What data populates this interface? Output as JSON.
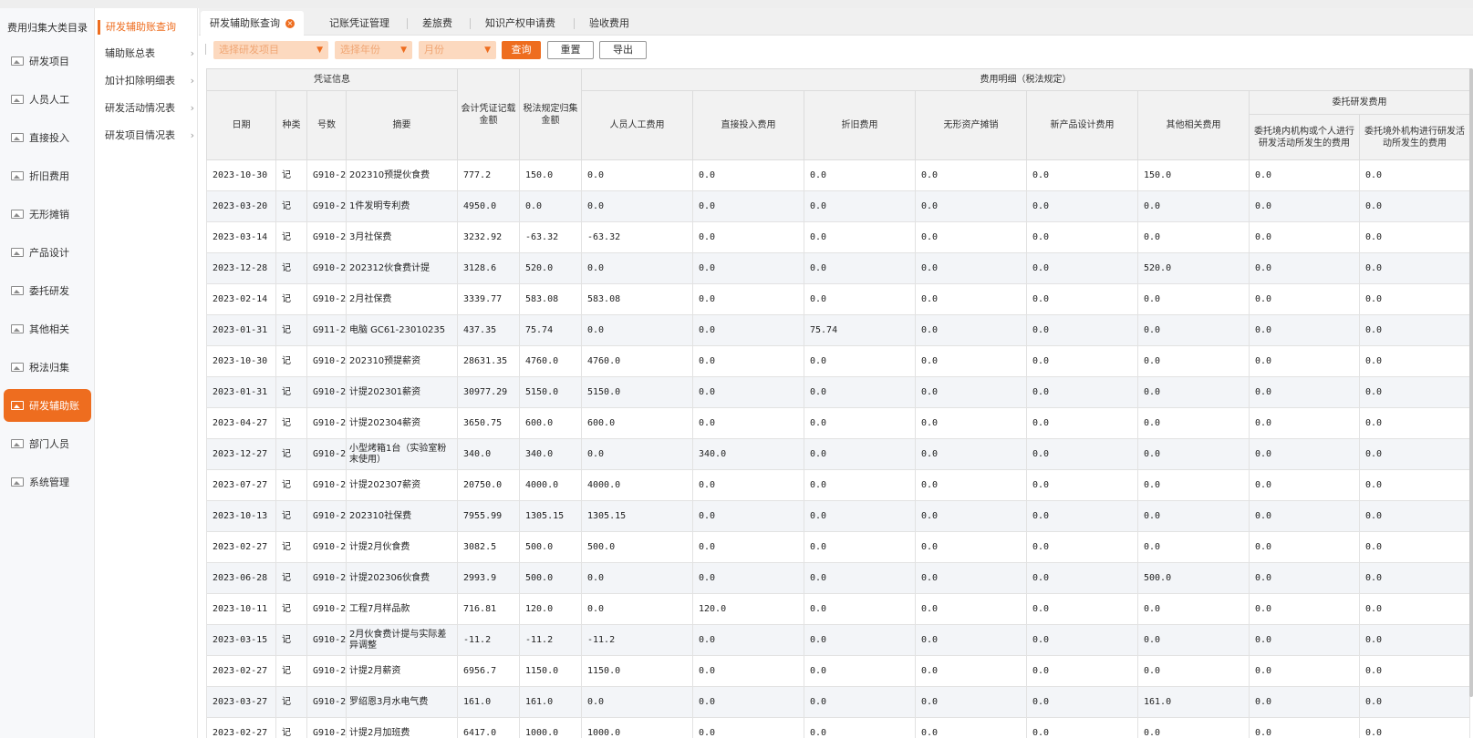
{
  "sidebar": {
    "title": "费用归集大类目录",
    "items": [
      {
        "label": "研发项目",
        "active": false
      },
      {
        "label": "人员人工",
        "active": false
      },
      {
        "label": "直接投入",
        "active": false
      },
      {
        "label": "折旧费用",
        "active": false
      },
      {
        "label": "无形摊销",
        "active": false
      },
      {
        "label": "产品设计",
        "active": false
      },
      {
        "label": "委托研发",
        "active": false
      },
      {
        "label": "其他相关",
        "active": false
      },
      {
        "label": "税法归集",
        "active": false
      },
      {
        "label": "研发辅助账",
        "active": true
      },
      {
        "label": "部门人员",
        "active": false
      },
      {
        "label": "系统管理",
        "active": false
      }
    ]
  },
  "submenu": {
    "header": "研发辅助账查询",
    "items": [
      "辅助账总表",
      "加计扣除明细表",
      "研发活动情况表",
      "研发项目情况表"
    ],
    "chevron": "›"
  },
  "tabs": [
    {
      "label": "研发辅助账查询",
      "active": true,
      "close": "×"
    },
    {
      "label": "记账凭证管理",
      "active": false
    },
    {
      "label": "差旅费",
      "active": false
    },
    {
      "label": "知识产权申请费",
      "active": false
    },
    {
      "label": "验收费用",
      "active": false
    }
  ],
  "toolbar": {
    "project_placeholder": "选择研发项目",
    "year_placeholder": "选择年份",
    "month_placeholder": "月份",
    "caret": "▼",
    "query_label": "查询",
    "reset_label": "重置",
    "export_label": "导出"
  },
  "table": {
    "group_voucher": "凭证信息",
    "group_detail": "费用明细（税法规定）",
    "group_entrusted": "委托研发费用",
    "col_date": "日期",
    "col_type": "种类",
    "col_number": "号数",
    "col_summary": "摘要",
    "col_acct_amount": "会计凭证记载金额",
    "col_tax_amount": "税法规定归集金额",
    "col_labor": "人员人工费用",
    "col_direct": "直接投入费用",
    "col_depreciation": "折旧费用",
    "col_intangible": "无形资产摊销",
    "col_design": "新产品设计费用",
    "col_other": "其他相关费用",
    "col_entrust_domestic": "委托境内机构或个人进行研发活动所发生的费用",
    "col_entrust_foreign": "委托境外机构进行研发活动所发生的费用",
    "rows": [
      [
        "2023-10-30",
        "记",
        "G910-2",
        "202310预提伙食费",
        "777.2",
        "150.0",
        "0.0",
        "0.0",
        "0.0",
        "0.0",
        "0.0",
        "150.0",
        "0.0",
        "0.0"
      ],
      [
        "2023-03-20",
        "记",
        "G910-2",
        "1件发明专利费",
        "4950.0",
        "0.0",
        "0.0",
        "0.0",
        "0.0",
        "0.0",
        "0.0",
        "0.0",
        "0.0",
        "0.0"
      ],
      [
        "2023-03-14",
        "记",
        "G910-2",
        "3月社保费",
        "3232.92",
        "-63.32",
        "-63.32",
        "0.0",
        "0.0",
        "0.0",
        "0.0",
        "0.0",
        "0.0",
        "0.0"
      ],
      [
        "2023-12-28",
        "记",
        "G910-2",
        "202312伙食费计提",
        "3128.6",
        "520.0",
        "0.0",
        "0.0",
        "0.0",
        "0.0",
        "0.0",
        "520.0",
        "0.0",
        "0.0"
      ],
      [
        "2023-02-14",
        "记",
        "G910-2",
        "2月社保费",
        "3339.77",
        "583.08",
        "583.08",
        "0.0",
        "0.0",
        "0.0",
        "0.0",
        "0.0",
        "0.0",
        "0.0"
      ],
      [
        "2023-01-31",
        "记",
        "G911-2",
        "电脑 GC61-23010235",
        "437.35",
        "75.74",
        "0.0",
        "0.0",
        "75.74",
        "0.0",
        "0.0",
        "0.0",
        "0.0",
        "0.0"
      ],
      [
        "2023-10-30",
        "记",
        "G910-2",
        "202310预提薪资",
        "28631.35",
        "4760.0",
        "4760.0",
        "0.0",
        "0.0",
        "0.0",
        "0.0",
        "0.0",
        "0.0",
        "0.0"
      ],
      [
        "2023-01-31",
        "记",
        "G910-2",
        "计提202301薪资",
        "30977.29",
        "5150.0",
        "5150.0",
        "0.0",
        "0.0",
        "0.0",
        "0.0",
        "0.0",
        "0.0",
        "0.0"
      ],
      [
        "2023-04-27",
        "记",
        "G910-2",
        "计提202304薪资",
        "3650.75",
        "600.0",
        "600.0",
        "0.0",
        "0.0",
        "0.0",
        "0.0",
        "0.0",
        "0.0",
        "0.0"
      ],
      [
        "2023-12-27",
        "记",
        "G910-2",
        "小型烤箱1台（实验室粉末使用）",
        "340.0",
        "340.0",
        "0.0",
        "340.0",
        "0.0",
        "0.0",
        "0.0",
        "0.0",
        "0.0",
        "0.0"
      ],
      [
        "2023-07-27",
        "记",
        "G910-2",
        "计提202307薪资",
        "20750.0",
        "4000.0",
        "4000.0",
        "0.0",
        "0.0",
        "0.0",
        "0.0",
        "0.0",
        "0.0",
        "0.0"
      ],
      [
        "2023-10-13",
        "记",
        "G910-2",
        "202310社保费",
        "7955.99",
        "1305.15",
        "1305.15",
        "0.0",
        "0.0",
        "0.0",
        "0.0",
        "0.0",
        "0.0",
        "0.0"
      ],
      [
        "2023-02-27",
        "记",
        "G910-2",
        "计提2月伙食费",
        "3082.5",
        "500.0",
        "500.0",
        "0.0",
        "0.0",
        "0.0",
        "0.0",
        "0.0",
        "0.0",
        "0.0"
      ],
      [
        "2023-06-28",
        "记",
        "G910-2",
        "计提202306伙食费",
        "2993.9",
        "500.0",
        "0.0",
        "0.0",
        "0.0",
        "0.0",
        "0.0",
        "500.0",
        "0.0",
        "0.0"
      ],
      [
        "2023-10-11",
        "记",
        "G910-2",
        "工程7月样品款",
        "716.81",
        "120.0",
        "0.0",
        "120.0",
        "0.0",
        "0.0",
        "0.0",
        "0.0",
        "0.0",
        "0.0"
      ],
      [
        "2023-03-15",
        "记",
        "G910-2",
        "2月伙食费计提与实际差异调整",
        "-11.2",
        "-11.2",
        "-11.2",
        "0.0",
        "0.0",
        "0.0",
        "0.0",
        "0.0",
        "0.0",
        "0.0"
      ],
      [
        "2023-02-27",
        "记",
        "G910-2",
        "计提2月薪资",
        "6956.7",
        "1150.0",
        "1150.0",
        "0.0",
        "0.0",
        "0.0",
        "0.0",
        "0.0",
        "0.0",
        "0.0"
      ],
      [
        "2023-03-27",
        "记",
        "G910-2",
        "罗绍恩3月水电气费",
        "161.0",
        "161.0",
        "0.0",
        "0.0",
        "0.0",
        "0.0",
        "0.0",
        "161.0",
        "0.0",
        "0.0"
      ],
      [
        "2023-02-27",
        "记",
        "G910-2",
        "计提2月加班费",
        "6417.0",
        "1000.0",
        "1000.0",
        "0.0",
        "0.0",
        "0.0",
        "0.0",
        "0.0",
        "0.0",
        "0.0"
      ]
    ]
  },
  "colors": {
    "accent": "#ee6d1f",
    "select_bg": "#fcd9bf",
    "row_alt": "#f3f5f8",
    "header_bg": "#f2f2f2"
  }
}
